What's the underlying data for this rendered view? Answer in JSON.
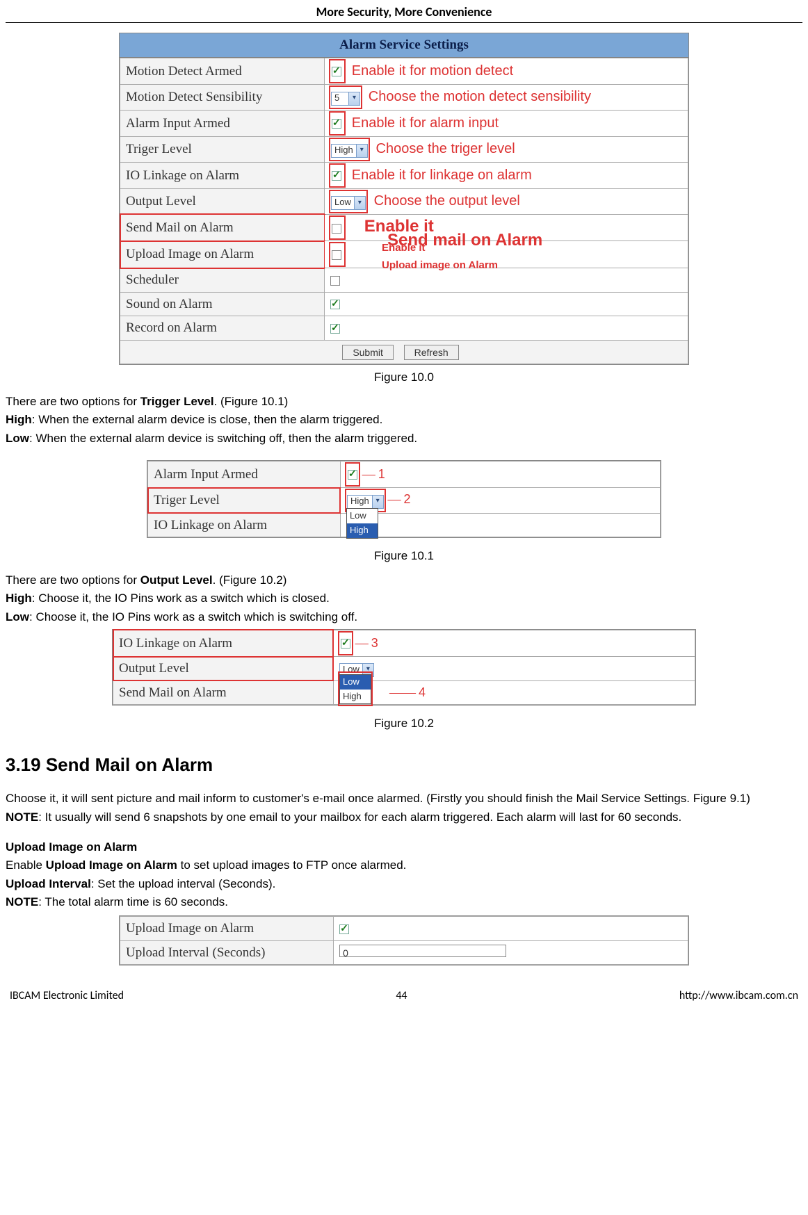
{
  "header": {
    "title": "More Security, More Convenience"
  },
  "footer": {
    "left": "IBCAM Electronic Limited",
    "page": "44",
    "right": "http://www.ibcam.com.cn"
  },
  "fig100": {
    "caption": "Figure 10.0",
    "title": "Alarm Service Settings",
    "rows": {
      "r1": {
        "label": "Motion Detect Armed",
        "ann": "Enable it for motion detect"
      },
      "r2": {
        "label": "Motion Detect Sensibility",
        "val": "5",
        "ann": "Choose the motion detect sensibility"
      },
      "r3": {
        "label": "Alarm Input Armed",
        "ann": "Enable it for alarm input"
      },
      "r4": {
        "label": "Triger Level",
        "val": "High",
        "ann": "Choose the triger level"
      },
      "r5": {
        "label": "IO Linkage on Alarm",
        "ann": "Enable it for linkage on alarm"
      },
      "r6": {
        "label": "Output Level",
        "val": "Low",
        "ann": "Choose the output level"
      },
      "r7": {
        "label": "Send Mail on Alarm",
        "ann1": "Enable it",
        "ann2": "Send mail on Alarm"
      },
      "r8": {
        "label": "Upload Image on Alarm",
        "ann1": "Enable it",
        "ann2": "Upload image on Alarm"
      },
      "r9": {
        "label": "Scheduler"
      },
      "r10": {
        "label": "Sound on Alarm"
      },
      "r11": {
        "label": "Record on Alarm"
      }
    },
    "buttons": {
      "submit": "Submit",
      "refresh": "Refresh"
    }
  },
  "text1": {
    "line1a": "There are two options for ",
    "line1b": "Trigger Level",
    "line1c": ". (Figure 10.1)",
    "high_l": "High",
    "high_t": ": When the external alarm device is close, then the alarm triggered.",
    "low_l": "Low",
    "low_t": ": When the external alarm device is switching off, then the alarm triggered."
  },
  "fig101": {
    "caption": "Figure 10.1",
    "r1": "Alarm Input Armed",
    "r2": "Triger Level",
    "sel": "High",
    "r3": "IO Linkage on Alarm",
    "opts": {
      "a": "Low",
      "b": "High"
    },
    "n1": "1",
    "n2": "2"
  },
  "text2": {
    "line1a": "There are two options for ",
    "line1b": "Output Level",
    "line1c": ". (Figure 10.2)",
    "high_l": "High",
    "high_t": ": Choose it, the IO Pins work as a switch which is closed.",
    "low_l": "Low",
    "low_t": ": Choose it, the IO Pins work as a switch which is switching off."
  },
  "fig102": {
    "caption": "Figure 10.2",
    "r1": "IO Linkage on Alarm",
    "r2": "Output Level",
    "sel": "Low",
    "r3": "Send Mail on Alarm",
    "opts": {
      "a": "Low",
      "b": "High"
    },
    "n3": "3",
    "n4": "4"
  },
  "section": {
    "heading": "3.19 Send Mail on Alarm",
    "p1": "Choose it, it will sent picture and mail inform to customer's e-mail once alarmed. (Firstly you should finish the Mail Service Settings. Figure 9.1)",
    "note_l": "NOTE",
    "note_t": ": It usually will send 6 snapshots by one email to your mailbox for each alarm triggered. Each alarm will last for 60 seconds.",
    "sub": "Upload Image on Alarm",
    "p2a": "Enable ",
    "p2b": "Upload Image on Alarm",
    "p2c": " to set upload images to FTP once alarmed.",
    "p3a": "Upload Interval",
    "p3b": ": Set the upload interval (Seconds).",
    "p4a": "NOTE",
    "p4b": ": The total alarm time is 60 seconds."
  },
  "fig_last": {
    "r1": "Upload Image on Alarm",
    "r2": "Upload Interval (Seconds)",
    "val": "0"
  }
}
